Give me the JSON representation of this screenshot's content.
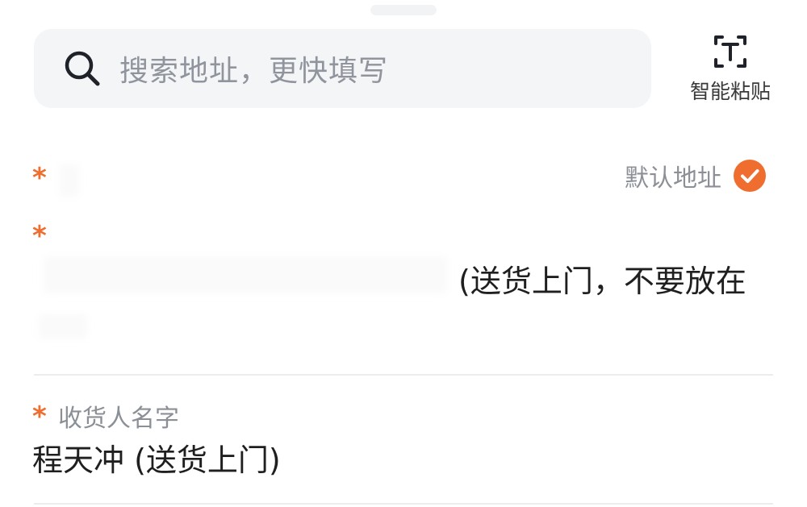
{
  "search": {
    "placeholder": "搜索地址，更快填写",
    "icon": "search-icon"
  },
  "smart_paste": {
    "label": "智能粘贴",
    "icon": "text-scan-icon"
  },
  "address_section": {
    "required_mark": "*",
    "default_label": "默认地址",
    "default_checked": true,
    "address_note": "(送货上门，不要放在",
    "accent_color": "#ee6d2f"
  },
  "recipient": {
    "required_mark": "*",
    "label": "收货人名字",
    "value": "程天冲 (送货上门)"
  }
}
